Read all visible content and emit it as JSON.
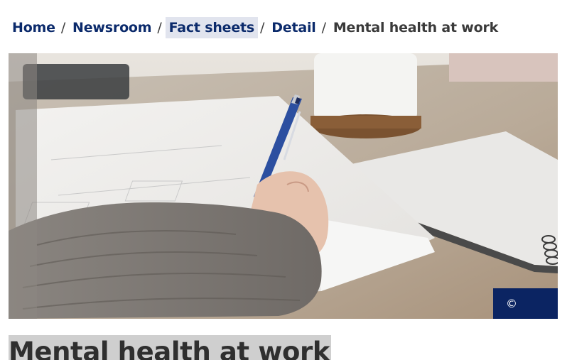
{
  "breadcrumb": {
    "items": [
      {
        "label": "Home"
      },
      {
        "label": "Newsroom"
      },
      {
        "label": "Fact sheets"
      },
      {
        "label": "Detail"
      }
    ],
    "separator": "/",
    "current": "Mental health at work"
  },
  "hero": {
    "copyright_symbol": "©"
  },
  "page": {
    "title": "Mental health at work"
  },
  "colors": {
    "link": "#0b2a6b",
    "highlight": "#e1e4ee",
    "badge": "#0b2462",
    "title_bg": "#cfcfcf"
  }
}
